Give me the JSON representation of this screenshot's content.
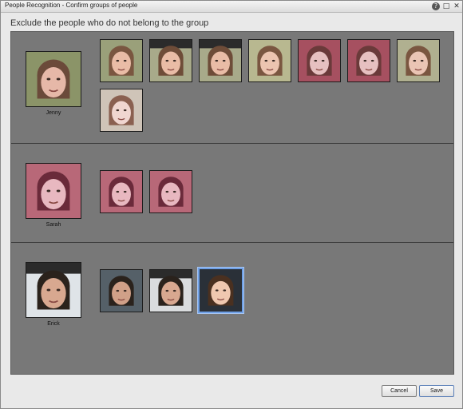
{
  "window": {
    "title": "People Recognition - Confirm groups of people",
    "help_icon": "?",
    "maximize_icon": "□",
    "close_icon": "✕"
  },
  "heading": "Exclude the people who do not belong to the group",
  "groups": [
    {
      "name": "Jenny",
      "rep": {
        "skin": "#e6b8a8",
        "hair": "#6b4a3a",
        "bg": "#8b9468",
        "band": false
      },
      "faces": [
        {
          "skin": "#e9bca6",
          "hair": "#7a5640",
          "bg": "#9aa07a",
          "band": false
        },
        {
          "skin": "#e9bca6",
          "hair": "#6e4c38",
          "bg": "#a8aa8a",
          "band": true
        },
        {
          "skin": "#e9bca6",
          "hair": "#6e4c38",
          "bg": "#a8aa8a",
          "band": true
        },
        {
          "skin": "#ecc4b0",
          "hair": "#7a5640",
          "bg": "#b8b890",
          "band": false
        },
        {
          "skin": "#e6c0c0",
          "hair": "#6a3a3a",
          "bg": "#a65060",
          "band": false
        },
        {
          "skin": "#e6c0c0",
          "hair": "#6a3a3a",
          "bg": "#a65060",
          "band": false
        },
        {
          "skin": "#eac4b4",
          "hair": "#7a5640",
          "bg": "#b0b090",
          "band": false
        },
        {
          "skin": "#f0d6d0",
          "hair": "#8a6050",
          "bg": "#cfc4b8",
          "band": false
        }
      ]
    },
    {
      "name": "Sarah",
      "rep": {
        "skin": "#e8b8c0",
        "hair": "#6a2a3a",
        "bg": "#b86878",
        "band": false
      },
      "faces": [
        {
          "skin": "#e8b8c0",
          "hair": "#6a2a3a",
          "bg": "#b86878",
          "band": false
        },
        {
          "skin": "#e8b8c0",
          "hair": "#6a2a3a",
          "bg": "#b86878",
          "band": false
        }
      ]
    },
    {
      "name": "Erick",
      "rep": {
        "skin": "#d8a890",
        "hair": "#2a221c",
        "bg": "#dfe4e8",
        "band": true
      },
      "faces": [
        {
          "skin": "#d0a088",
          "hair": "#2a221c",
          "bg": "#556068",
          "band": false
        },
        {
          "skin": "#d8a890",
          "hair": "#2a221c",
          "bg": "#dadcde",
          "band": true
        },
        {
          "skin": "#f0c8b0",
          "hair": "#4a3020",
          "bg": "#2a3038",
          "band": false,
          "selected": true
        }
      ]
    }
  ],
  "buttons": {
    "cancel": "Cancel",
    "save": "Save"
  }
}
